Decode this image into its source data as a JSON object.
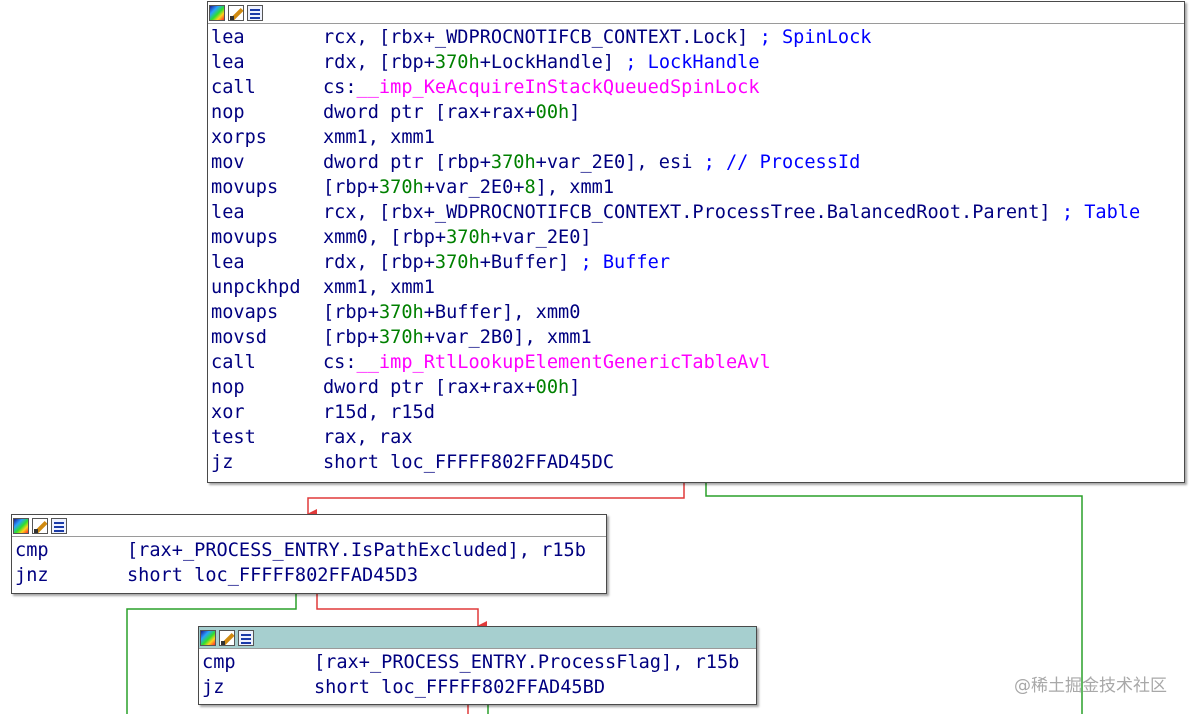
{
  "colors": {
    "edge_true": "#e03a3a",
    "edge_false": "#2aa02a",
    "text_default": "#000080",
    "text_number": "#008000",
    "text_comment": "#0000ff",
    "text_import": "#ff00ff",
    "active_header": "#a6cfcf"
  },
  "header_icons": [
    "palette-icon",
    "edit-icon",
    "graph-icon"
  ],
  "nodes": [
    {
      "id": "block-main",
      "lines": [
        {
          "mnem": "lea",
          "ops": [
            {
              "t": "rcx, [rbx+_WDPROCNOTIFCB_CONTEXT.Lock] ",
              "c": "d"
            },
            {
              "t": "; SpinLock",
              "c": "c"
            }
          ]
        },
        {
          "mnem": "lea",
          "ops": [
            {
              "t": "rdx, [rbp+",
              "c": "d"
            },
            {
              "t": "370h",
              "c": "n"
            },
            {
              "t": "+LockHandle] ",
              "c": "d"
            },
            {
              "t": "; LockHandle",
              "c": "c"
            }
          ]
        },
        {
          "mnem": "call",
          "ops": [
            {
              "t": "cs:",
              "c": "d"
            },
            {
              "t": "__imp_KeAcquireInStackQueuedSpinLock",
              "c": "i"
            }
          ]
        },
        {
          "mnem": "nop",
          "ops": [
            {
              "t": "dword ptr [rax+rax+",
              "c": "d"
            },
            {
              "t": "00h",
              "c": "n"
            },
            {
              "t": "]",
              "c": "d"
            }
          ]
        },
        {
          "mnem": "xorps",
          "ops": [
            {
              "t": "xmm1, xmm1",
              "c": "d"
            }
          ]
        },
        {
          "mnem": "mov",
          "ops": [
            {
              "t": "dword ptr [rbp+",
              "c": "d"
            },
            {
              "t": "370h",
              "c": "n"
            },
            {
              "t": "+var_2E0], esi ",
              "c": "d"
            },
            {
              "t": "; // ProcessId",
              "c": "c"
            }
          ]
        },
        {
          "mnem": "movups",
          "ops": [
            {
              "t": "[rbp+",
              "c": "d"
            },
            {
              "t": "370h",
              "c": "n"
            },
            {
              "t": "+var_2E0+",
              "c": "d"
            },
            {
              "t": "8",
              "c": "n"
            },
            {
              "t": "], xmm1",
              "c": "d"
            }
          ]
        },
        {
          "mnem": "lea",
          "ops": [
            {
              "t": "rcx, [rbx+_WDPROCNOTIFCB_CONTEXT.ProcessTree.BalancedRoot.Parent] ",
              "c": "d"
            },
            {
              "t": "; Table",
              "c": "c"
            }
          ]
        },
        {
          "mnem": "movups",
          "ops": [
            {
              "t": "xmm0, [rbp+",
              "c": "d"
            },
            {
              "t": "370h",
              "c": "n"
            },
            {
              "t": "+var_2E0]",
              "c": "d"
            }
          ]
        },
        {
          "mnem": "lea",
          "ops": [
            {
              "t": "rdx, [rbp+",
              "c": "d"
            },
            {
              "t": "370h",
              "c": "n"
            },
            {
              "t": "+Buffer] ",
              "c": "d"
            },
            {
              "t": "; Buffer",
              "c": "c"
            }
          ]
        },
        {
          "mnem": "unpckhpd",
          "ops": [
            {
              "t": "xmm1, xmm1",
              "c": "d"
            }
          ]
        },
        {
          "mnem": "movaps",
          "ops": [
            {
              "t": "[rbp+",
              "c": "d"
            },
            {
              "t": "370h",
              "c": "n"
            },
            {
              "t": "+Buffer], xmm0",
              "c": "d"
            }
          ]
        },
        {
          "mnem": "movsd",
          "ops": [
            {
              "t": "[rbp+",
              "c": "d"
            },
            {
              "t": "370h",
              "c": "n"
            },
            {
              "t": "+var_2B0], xmm1",
              "c": "d"
            }
          ]
        },
        {
          "mnem": "call",
          "ops": [
            {
              "t": "cs:",
              "c": "d"
            },
            {
              "t": "__imp_RtlLookupElementGenericTableAvl",
              "c": "i"
            }
          ]
        },
        {
          "mnem": "nop",
          "ops": [
            {
              "t": "dword ptr [rax+rax+",
              "c": "d"
            },
            {
              "t": "00h",
              "c": "n"
            },
            {
              "t": "]",
              "c": "d"
            }
          ]
        },
        {
          "mnem": "xor",
          "ops": [
            {
              "t": "r15d, r15d",
              "c": "d"
            }
          ]
        },
        {
          "mnem": "test",
          "ops": [
            {
              "t": "rax, rax",
              "c": "d"
            }
          ]
        },
        {
          "mnem": "jz",
          "ops": [
            {
              "t": "short loc_FFFFF802FFAD45DC",
              "c": "d"
            }
          ]
        }
      ]
    },
    {
      "id": "block-check-excluded",
      "lines": [
        {
          "mnem": "cmp",
          "ops": [
            {
              "t": "[rax+_PROCESS_ENTRY.IsPathExcluded], r15b",
              "c": "d"
            }
          ]
        },
        {
          "mnem": "jnz",
          "ops": [
            {
              "t": "short loc_FFFFF802FFAD45D3",
              "c": "d"
            }
          ]
        }
      ]
    },
    {
      "id": "block-check-flag",
      "lines": [
        {
          "mnem": "cmp",
          "ops": [
            {
              "t": "[rax+_PROCESS_ENTRY.ProcessFlag], r15b",
              "c": "d"
            }
          ]
        },
        {
          "mnem": "jz",
          "ops": [
            {
              "t": "short loc_FFFFF802FFAD45BD",
              "c": "d"
            }
          ]
        }
      ]
    }
  ],
  "watermark": "@稀土掘金技术社区"
}
